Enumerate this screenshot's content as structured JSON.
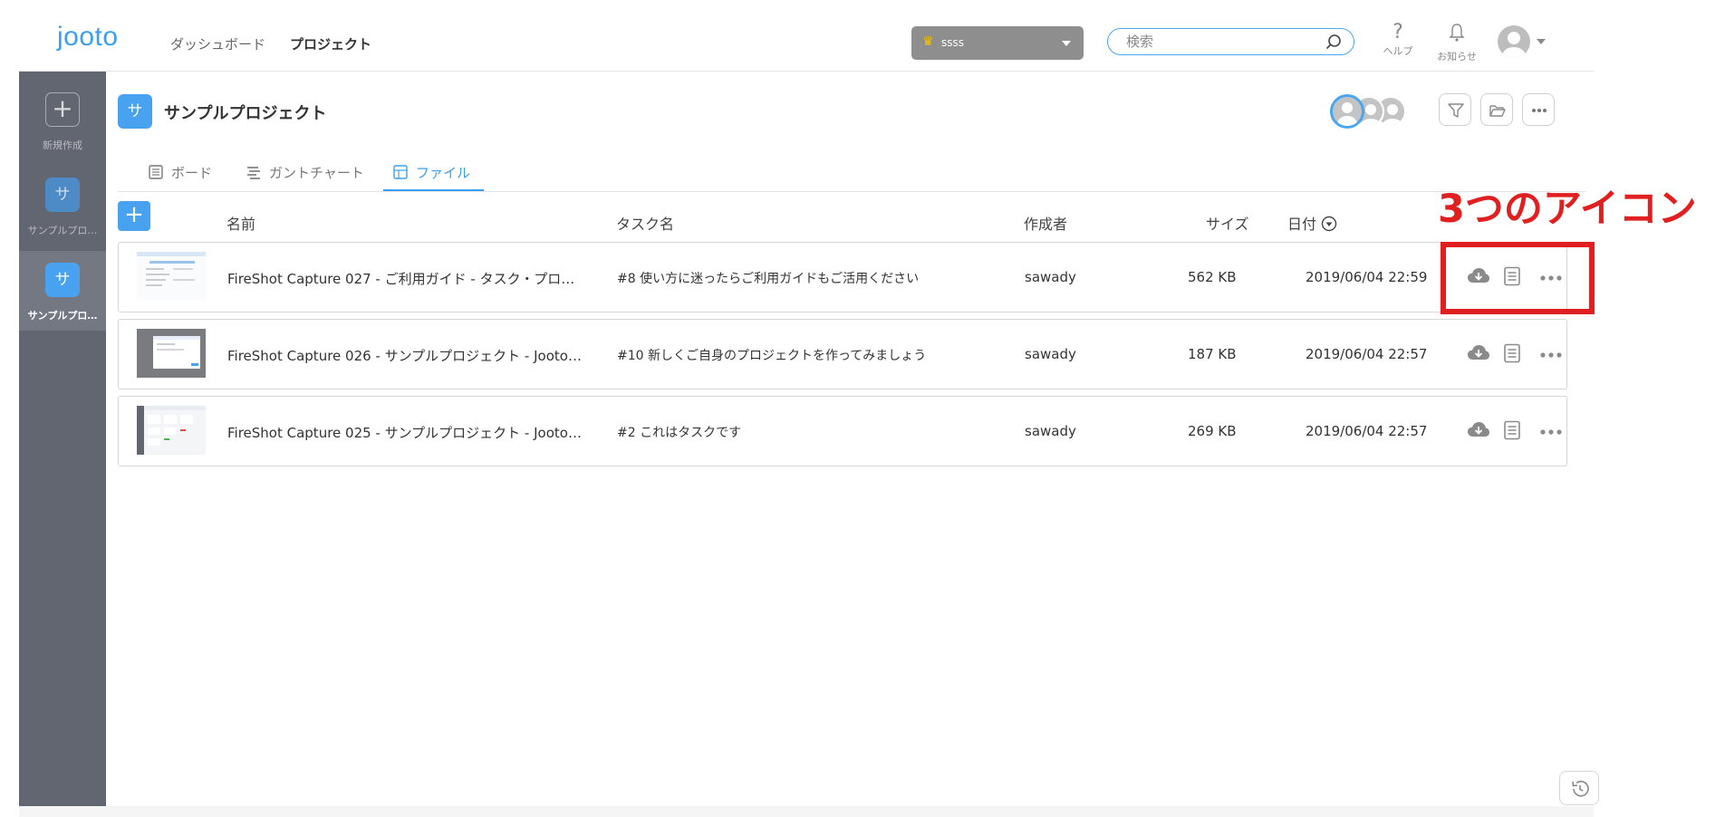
{
  "header": {
    "logo": "jooto",
    "nav": {
      "dashboard": "ダッシュボード",
      "project": "プロジェクト"
    },
    "workspace": "ssss",
    "search_placeholder": "検索",
    "help_label": "ヘルプ",
    "help_glyph": "?",
    "notifications_label": "お知らせ"
  },
  "sidebar": {
    "new_label": "新規作成",
    "new_symbol": "+",
    "projects": [
      {
        "initial": "サ",
        "label": "サンプルプロ…"
      },
      {
        "initial": "サ",
        "label": "サンプルプロ…"
      }
    ]
  },
  "project": {
    "initial": "サ",
    "title": "サンプルプロジェクト"
  },
  "tabs": [
    {
      "label": "ボード",
      "icon": "board-icon"
    },
    {
      "label": "ガントチャート",
      "icon": "gantt-icon"
    },
    {
      "label": "ファイル",
      "icon": "file-icon",
      "active": true
    }
  ],
  "table": {
    "add_symbol": "+",
    "columns": {
      "name": "名前",
      "task": "タスク名",
      "author": "作成者",
      "size": "サイズ",
      "date": "日付"
    },
    "rows": [
      {
        "name": "FireShot Capture 027 - ご利用ガイド - タスク・プロ…",
        "task": "#8 使い方に迷ったらご利用ガイドもご活用ください",
        "author": "sawady",
        "size": "562 KB",
        "date": "2019/06/04 22:59"
      },
      {
        "name": "FireShot Capture 026 - サンプルプロジェクト - Jooto…",
        "task": "#10 新しくご自身のプロジェクトを作ってみましょう",
        "author": "sawady",
        "size": "187 KB",
        "date": "2019/06/04 22:57"
      },
      {
        "name": "FireShot Capture 025 - サンプルプロジェクト - Jooto…",
        "task": "#2 これはタスクです",
        "author": "sawady",
        "size": "269 KB",
        "date": "2019/06/04 22:57"
      }
    ]
  },
  "annotation": {
    "text": "3つのアイコン",
    "color": "#e02020"
  },
  "colors": {
    "accent": "#48a2f0",
    "sidebar": "#626670",
    "annotation": "#e02020"
  }
}
